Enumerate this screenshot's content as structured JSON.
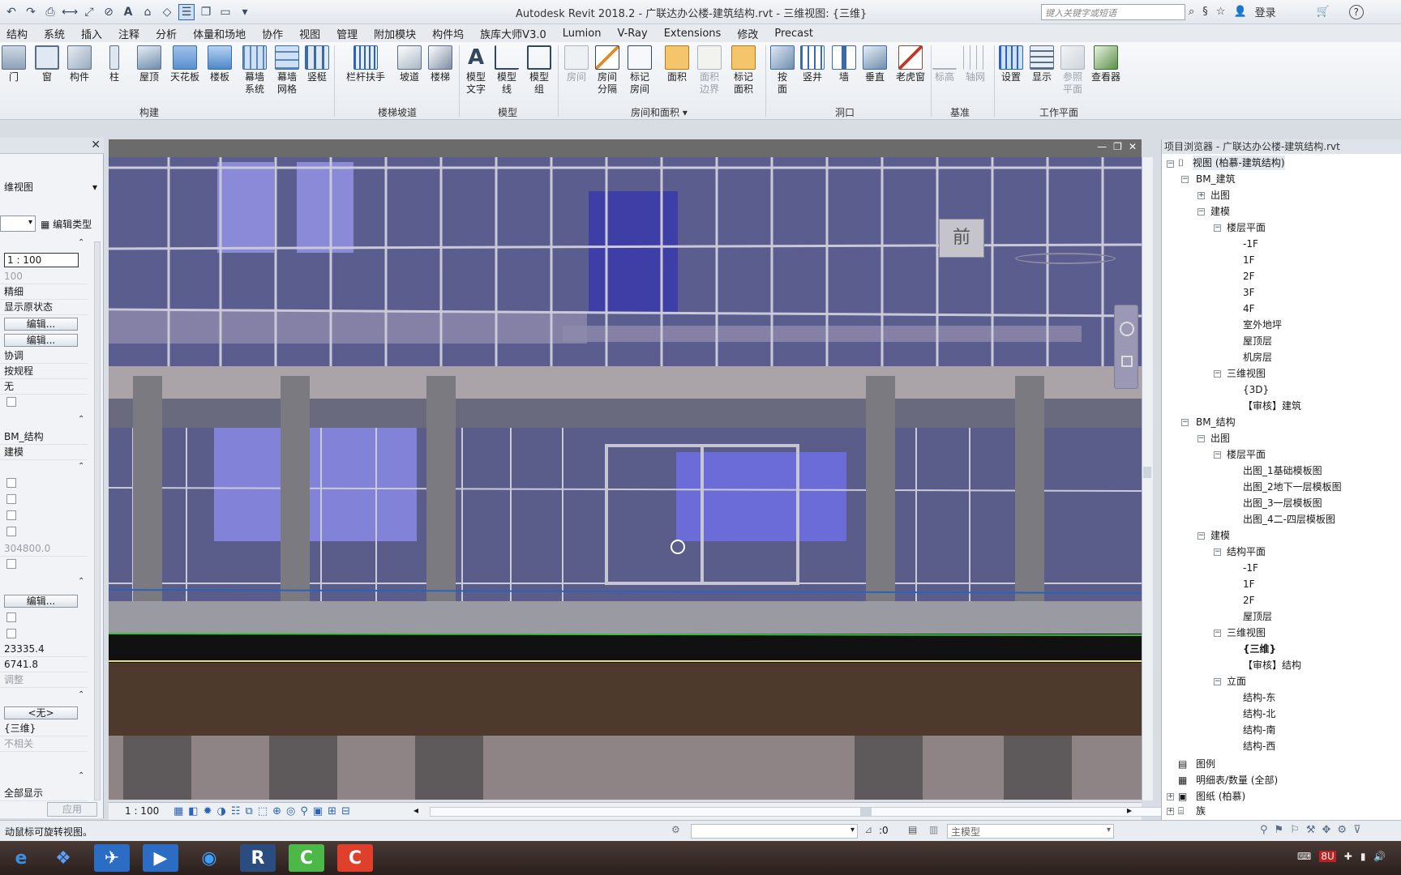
{
  "titlebar": {
    "title": "Autodesk Revit 2018.2 -   广联达办公楼-建筑结构.rvt - 三维视图: {三维}",
    "search_placeholder": "键入关键字或短语",
    "login": "登录",
    "help": "?"
  },
  "menu": [
    "结构",
    "系统",
    "插入",
    "注释",
    "分析",
    "体量和场地",
    "协作",
    "视图",
    "管理",
    "附加模块",
    "构件坞",
    "族库大师V3.0",
    "Lumion",
    "V-Ray",
    "Extensions",
    "修改",
    "Precast"
  ],
  "ribbon": {
    "items": [
      {
        "label": "门"
      },
      {
        "label": "窗"
      },
      {
        "label": "构件"
      },
      {
        "label": "柱"
      },
      {
        "label": "屋顶"
      },
      {
        "label": "天花板"
      },
      {
        "label": "楼板"
      },
      {
        "label": "幕墙\n系统"
      },
      {
        "label": "幕墙\n网格"
      },
      {
        "label": "竖梃"
      },
      {
        "label": "栏杆扶手"
      },
      {
        "label": "坡道"
      },
      {
        "label": "楼梯"
      },
      {
        "label": "模型\n文字"
      },
      {
        "label": "模型\n线"
      },
      {
        "label": "模型\n组"
      },
      {
        "label": "房间"
      },
      {
        "label": "房间\n分隔"
      },
      {
        "label": "标记\n房间"
      },
      {
        "label": "面积"
      },
      {
        "label": "面积\n边界"
      },
      {
        "label": "标记\n面积"
      },
      {
        "label": "按\n面"
      },
      {
        "label": "竖井"
      },
      {
        "label": "墙"
      },
      {
        "label": "垂直"
      },
      {
        "label": "老虎窗"
      },
      {
        "label": "标高"
      },
      {
        "label": "轴网"
      },
      {
        "label": "设置"
      },
      {
        "label": "显示"
      },
      {
        "label": "参照\n平面"
      },
      {
        "label": "查看器"
      }
    ],
    "groups": [
      "构建",
      "楼梯坡道",
      "模型",
      "房间和面积",
      "洞口",
      "基准",
      "工作平面"
    ]
  },
  "properties": {
    "view_type": "维视图",
    "edit_type": "编辑类型",
    "scale": "1 : 100",
    "scale_value": "100",
    "detail_level": "精细",
    "parts_visibility": "显示原状态",
    "edit_btn": "编辑...",
    "discipline": "协调",
    "show_hidden": "按规程",
    "default_analysis": "无",
    "phase_filter": "BM_结构",
    "sub_discipline": "建模",
    "eye_elevation": "304800.0",
    "target_elevation": "23335.4",
    "camera_position": "6741.8",
    "adjust": "调整",
    "none_btn": "<无>",
    "view_name": "{三维}",
    "dependency": "不相关",
    "show_all": "全部显示",
    "apply": "应用"
  },
  "viewcube": {
    "face_label": "前"
  },
  "browser": {
    "header": "项目浏览器 - 广联达办公楼-建筑结构.rvt",
    "root": "视图 (柏慕-建筑结构)",
    "bm_arch": "BM_建筑",
    "output": "出图",
    "modeling": "建模",
    "floor_plans": "楼层平面",
    "arch_floors": [
      "-1F",
      "1F",
      "2F",
      "3F",
      "4F",
      "室外地坪",
      "屋顶层",
      "机房层"
    ],
    "views_3d": "三维视图",
    "arch_3d": [
      "{3D}",
      "【审核】建筑"
    ],
    "bm_struct": "BM_结构",
    "struct_output_floor": "楼层平面",
    "struct_output_items": [
      "出图_1基础模板图",
      "出图_2地下一层模板图",
      "出图_3一层模板图",
      "出图_4二-四层模板图"
    ],
    "struct_plans": "结构平面",
    "struct_floors": [
      "-1F",
      "1F",
      "2F",
      "屋顶层"
    ],
    "struct_3d": [
      "{三维}",
      "【审核】结构"
    ],
    "elevations": "立面",
    "struct_elev": [
      "结构-东",
      "结构-北",
      "结构-南",
      "结构-西"
    ],
    "legends": "图例",
    "schedules": "明细表/数量 (全部)",
    "sheets": "图纸 (柏慕)",
    "families": "族"
  },
  "view_status": {
    "scale": "1 : 100"
  },
  "status": {
    "message": "动鼠标可旋转视图。",
    "selection_count": ":0",
    "workset": "主模型"
  },
  "taskbar": {
    "apps": [
      "e",
      "❖",
      "✈",
      "▶",
      "◉",
      "R",
      "C",
      "C"
    ],
    "systray_temp": "8U"
  },
  "colors": {
    "accent": "#2a63b8",
    "glass": "#5a5d8f",
    "ground": "#4d3a2c"
  }
}
